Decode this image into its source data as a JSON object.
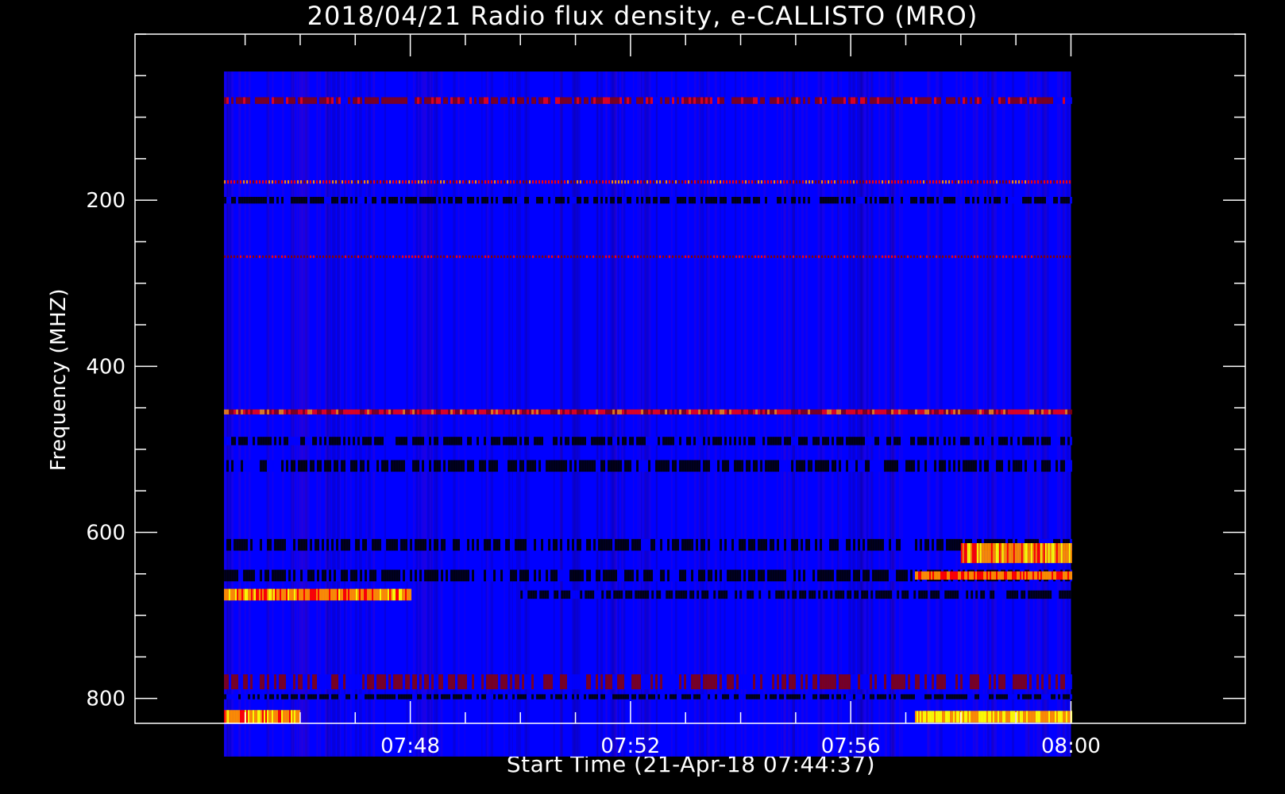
{
  "chart_data": {
    "type": "heatmap",
    "title": "2018/04/21  Radio flux density, e-CALLISTO (MRO)",
    "xlabel": "Start Time (21-Apr-18 07:44:37)",
    "ylabel": "Frequency (MHZ)",
    "x_axis": {
      "start": "07:44:37",
      "end": "08:00:00",
      "xlim": [
        "07:43:00",
        "08:03:10"
      ],
      "major_ticks": [
        "07:48",
        "07:52",
        "07:56",
        "08:00"
      ],
      "minor_tick_interval_min": 1
    },
    "y_axis": {
      "ylim": [
        830,
        0
      ],
      "data_range": [
        45,
        870
      ],
      "major_ticks": [
        200,
        400,
        600,
        800
      ],
      "minor_tick_interval": 50,
      "inverted": true
    },
    "colormap": [
      "#000000",
      "#0000ff",
      "#8b0000",
      "#ff0000",
      "#ff8c00",
      "#ffff00"
    ],
    "background_color": "#0000ff",
    "bands": [
      {
        "freq": 80,
        "width": 8,
        "t0": "07:44:37",
        "t1": "08:00:00",
        "intensity": 0.55,
        "kind": "stripes"
      },
      {
        "freq": 178,
        "width": 4,
        "t0": "07:44:37",
        "t1": "08:00:00",
        "intensity": 0.8,
        "kind": "dotted"
      },
      {
        "freq": 200,
        "width": 8,
        "t0": "07:44:37",
        "t1": "08:00:00",
        "intensity": 0.0,
        "kind": "dark"
      },
      {
        "freq": 268,
        "width": 3,
        "t0": "07:44:37",
        "t1": "08:00:00",
        "intensity": 0.6,
        "kind": "dotted"
      },
      {
        "freq": 455,
        "width": 6,
        "t0": "07:44:37",
        "t1": "08:00:00",
        "intensity": 0.75,
        "kind": "stripes"
      },
      {
        "freq": 490,
        "width": 10,
        "t0": "07:44:37",
        "t1": "08:00:00",
        "intensity": 0.1,
        "kind": "dark"
      },
      {
        "freq": 520,
        "width": 14,
        "t0": "07:44:37",
        "t1": "08:00:00",
        "intensity": 0.1,
        "kind": "dark"
      },
      {
        "freq": 615,
        "width": 14,
        "t0": "07:44:37",
        "t1": "08:00:00",
        "intensity": 0.1,
        "kind": "dark"
      },
      {
        "freq": 625,
        "width": 24,
        "t0": "07:58:00",
        "t1": "08:00:00",
        "intensity": 0.9,
        "kind": "burst"
      },
      {
        "freq": 652,
        "width": 14,
        "t0": "07:44:37",
        "t1": "08:00:00",
        "intensity": 0.05,
        "kind": "dark"
      },
      {
        "freq": 652,
        "width": 10,
        "t0": "07:57:10",
        "t1": "08:00:00",
        "intensity": 0.85,
        "kind": "burst"
      },
      {
        "freq": 675,
        "width": 14,
        "t0": "07:44:37",
        "t1": "07:48:00",
        "intensity": 0.9,
        "kind": "burst"
      },
      {
        "freq": 675,
        "width": 10,
        "t0": "07:50:00",
        "t1": "08:00:00",
        "intensity": 0.05,
        "kind": "dark"
      },
      {
        "freq": 780,
        "width": 18,
        "t0": "07:44:37",
        "t1": "08:00:00",
        "intensity": 0.45,
        "kind": "stripes"
      },
      {
        "freq": 798,
        "width": 6,
        "t0": "07:44:37",
        "t1": "08:00:00",
        "intensity": 0.05,
        "kind": "dark"
      },
      {
        "freq": 822,
        "width": 14,
        "t0": "07:57:10",
        "t1": "08:00:00",
        "intensity": 1.0,
        "kind": "burst"
      },
      {
        "freq": 822,
        "width": 16,
        "t0": "07:44:37",
        "t1": "07:46:00",
        "intensity": 0.95,
        "kind": "burst"
      }
    ]
  }
}
